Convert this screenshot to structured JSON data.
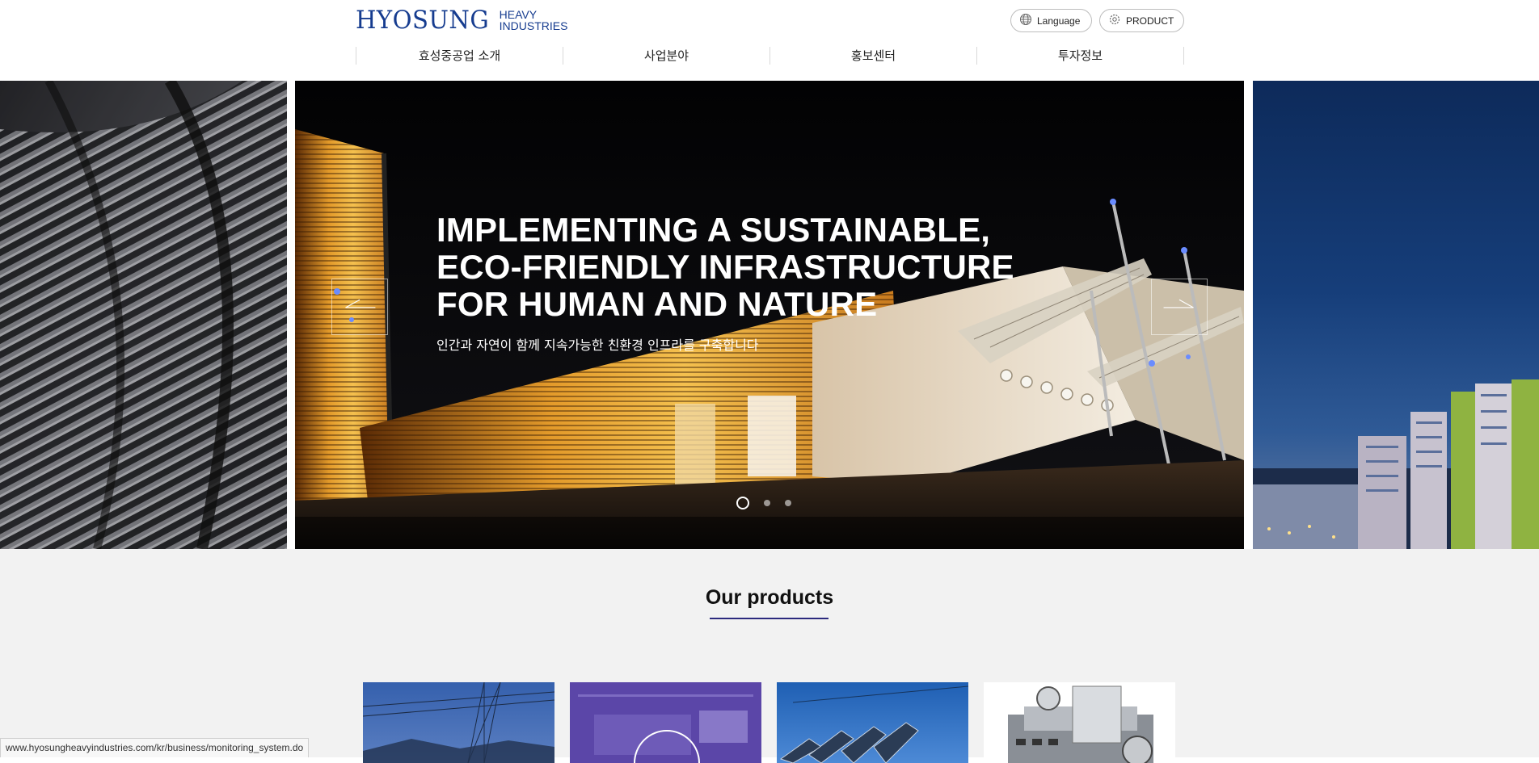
{
  "brand": {
    "logo_main": "HYOSUNG",
    "logo_sub_1": "HEAVY",
    "logo_sub_2": "INDUSTRIES",
    "color": "#163c8f"
  },
  "header": {
    "language_label": "Language",
    "product_label": "PRODUCT",
    "language_icon": "globe-icon",
    "product_icon": "gear-icon"
  },
  "nav": {
    "items": [
      {
        "label": "효성중공업 소개"
      },
      {
        "label": "사업분야"
      },
      {
        "label": "홍보센터"
      },
      {
        "label": "투자정보"
      }
    ]
  },
  "hero": {
    "title_line_1": "IMPLEMENTING A SUSTAINABLE,",
    "title_line_2": "ECO-FRIENDLY INFRASTRUCTURE",
    "title_line_3": "FOR HUMAN AND NATURE",
    "subtitle": "인간과 자연이 함께 지속가능한 친환경 인프라를 구축합니다",
    "prev_icon": "arrow-left-icon",
    "next_icon": "arrow-right-icon",
    "slide_count": 3,
    "active_slide": 1
  },
  "products": {
    "title": "Our products",
    "accent_color": "#2c2a7d"
  },
  "status_bar": {
    "url": "www.hyosungheavyindustries.com/kr/business/monitoring_system.do"
  }
}
